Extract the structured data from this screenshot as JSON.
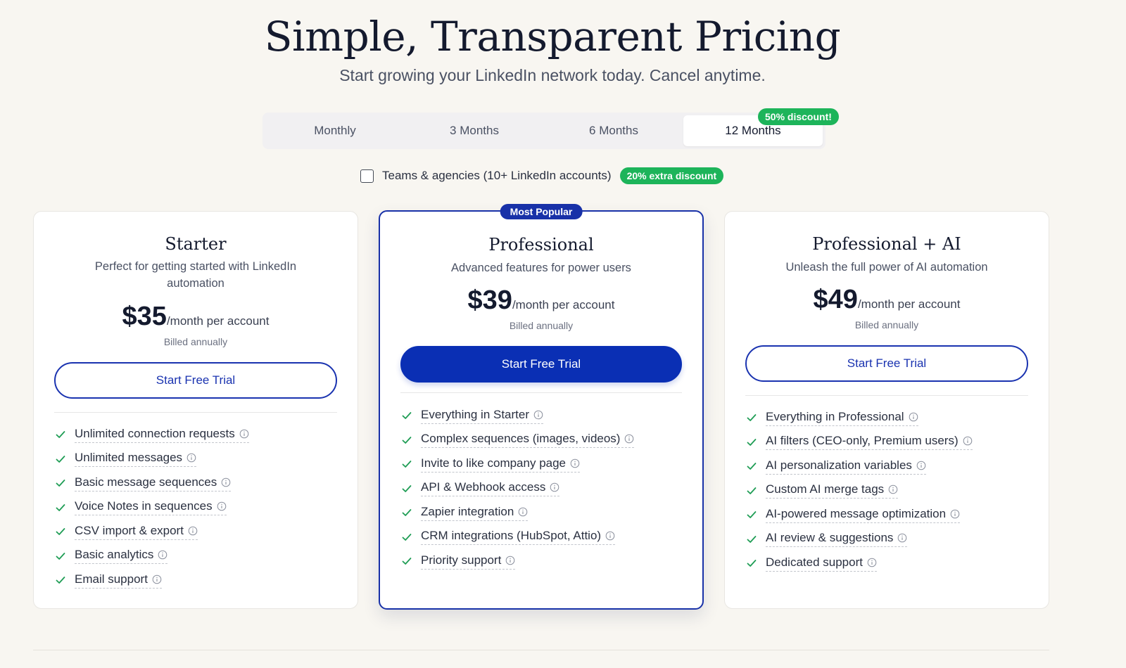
{
  "hero": {
    "title": "Simple, Transparent Pricing",
    "subtitle": "Start growing your LinkedIn network today. Cancel anytime."
  },
  "periods": {
    "tabs": [
      {
        "label": "Monthly",
        "active": false
      },
      {
        "label": "3 Months",
        "active": false
      },
      {
        "label": "6 Months",
        "active": false
      },
      {
        "label": "12 Months",
        "active": true
      }
    ],
    "discount_badge": "50% discount!"
  },
  "teams": {
    "label": "Teams & agencies (10+ LinkedIn accounts)",
    "checked": false,
    "badge": "20% extra discount"
  },
  "colors": {
    "accent": "#1831a8",
    "success": "#1db45a",
    "check": "#1f9d55"
  },
  "plans": [
    {
      "name": "Starter",
      "description": "Perfect for getting started with LinkedIn automation",
      "price": "$35",
      "unit": "/month per account",
      "billed": "Billed annually",
      "cta": "Start Free Trial",
      "features": [
        "Unlimited connection requests",
        "Unlimited messages",
        "Basic message sequences",
        "Voice Notes in sequences",
        "CSV import & export",
        "Basic analytics",
        "Email support"
      ]
    },
    {
      "name": "Professional",
      "badge": "Most Popular",
      "description": "Advanced features for power users",
      "price": "$39",
      "unit": "/month per account",
      "billed": "Billed annually",
      "cta": "Start Free Trial",
      "features": [
        "Everything in Starter",
        "Complex sequences (images, videos)",
        "Invite to like company page",
        "API & Webhook access",
        "Zapier integration",
        "CRM integrations (HubSpot, Attio)",
        "Priority support"
      ]
    },
    {
      "name": "Professional + AI",
      "description": "Unleash the full power of AI automation",
      "price": "$49",
      "unit": "/month per account",
      "billed": "Billed annually",
      "cta": "Start Free Trial",
      "features": [
        "Everything in Professional",
        "AI filters (CEO-only, Premium users)",
        "AI personalization variables",
        "Custom AI merge tags",
        "AI-powered message optimization",
        "AI review & suggestions",
        "Dedicated support"
      ]
    }
  ]
}
